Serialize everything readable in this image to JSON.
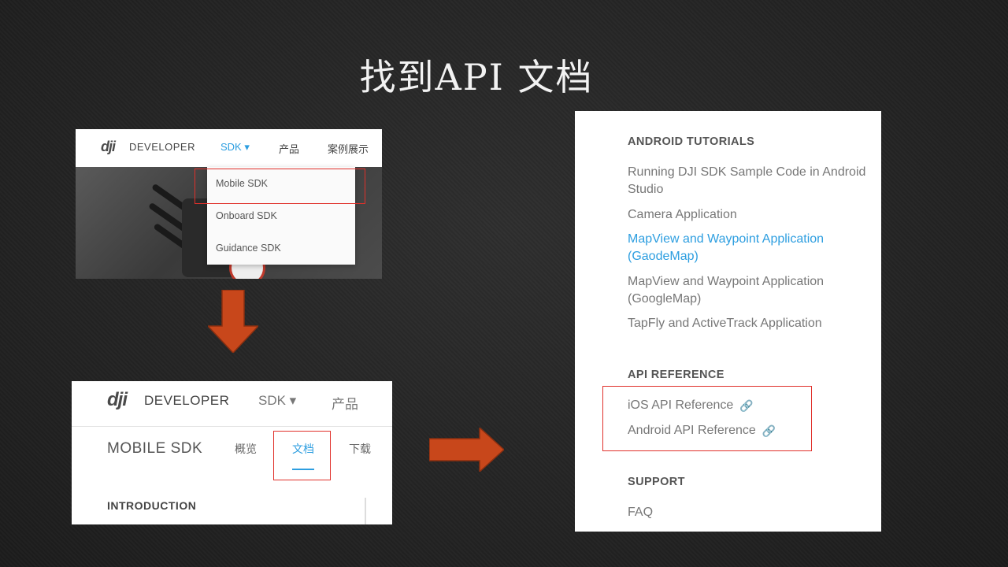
{
  "slide": {
    "title": "找到API 文档"
  },
  "shot1": {
    "logo": "dji",
    "logo_text": "DEVELOPER",
    "nav_sdk": "SDK ▾",
    "nav_products": "产品",
    "nav_cases": "案例展示",
    "dropdown": [
      "Mobile SDK",
      "Onboard SDK",
      "Guidance SDK"
    ]
  },
  "shot2": {
    "logo": "dji",
    "logo_text": "DEVELOPER",
    "nav_sdk": "SDK ▾",
    "nav_products": "产品",
    "sdk_title": "MOBILE SDK",
    "tabs": [
      "概览",
      "文档",
      "下载"
    ],
    "active_tab": "文档",
    "section_heading": "INTRODUCTION"
  },
  "shot3": {
    "android_tutorials": {
      "heading": "ANDROID TUTORIALS",
      "items": [
        "Running DJI SDK Sample Code in Android Studio",
        "Camera Application",
        "MapView and Waypoint Application (GaodeMap)",
        "MapView and Waypoint Application (GoogleMap)",
        "TapFly and ActiveTrack Application"
      ],
      "active_item": "MapView and Waypoint Application (GaodeMap)"
    },
    "api_reference": {
      "heading": "API REFERENCE",
      "items": [
        "iOS API Reference",
        "Android API Reference"
      ]
    },
    "support": {
      "heading": "SUPPORT",
      "items": [
        "FAQ"
      ]
    }
  },
  "colors": {
    "accent": "#2d9ee0",
    "highlight_box": "#e0302a",
    "arrow": "#c8471b",
    "background": "#262626"
  },
  "icons": {
    "arrow_down": "arrow-down-icon",
    "arrow_right": "arrow-right-icon",
    "external_link": "link-icon"
  }
}
